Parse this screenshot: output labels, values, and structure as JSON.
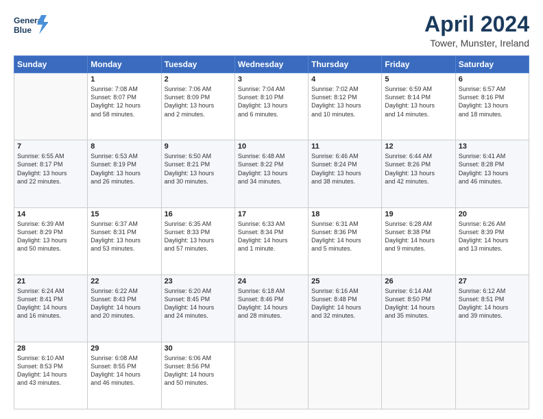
{
  "header": {
    "logo_line1": "General",
    "logo_line2": "Blue",
    "title": "April 2024",
    "subtitle": "Tower, Munster, Ireland"
  },
  "days_of_week": [
    "Sunday",
    "Monday",
    "Tuesday",
    "Wednesday",
    "Thursday",
    "Friday",
    "Saturday"
  ],
  "weeks": [
    [
      {
        "num": "",
        "info": ""
      },
      {
        "num": "1",
        "info": "Sunrise: 7:08 AM\nSunset: 8:07 PM\nDaylight: 12 hours\nand 58 minutes."
      },
      {
        "num": "2",
        "info": "Sunrise: 7:06 AM\nSunset: 8:09 PM\nDaylight: 13 hours\nand 2 minutes."
      },
      {
        "num": "3",
        "info": "Sunrise: 7:04 AM\nSunset: 8:10 PM\nDaylight: 13 hours\nand 6 minutes."
      },
      {
        "num": "4",
        "info": "Sunrise: 7:02 AM\nSunset: 8:12 PM\nDaylight: 13 hours\nand 10 minutes."
      },
      {
        "num": "5",
        "info": "Sunrise: 6:59 AM\nSunset: 8:14 PM\nDaylight: 13 hours\nand 14 minutes."
      },
      {
        "num": "6",
        "info": "Sunrise: 6:57 AM\nSunset: 8:16 PM\nDaylight: 13 hours\nand 18 minutes."
      }
    ],
    [
      {
        "num": "7",
        "info": "Sunrise: 6:55 AM\nSunset: 8:17 PM\nDaylight: 13 hours\nand 22 minutes."
      },
      {
        "num": "8",
        "info": "Sunrise: 6:53 AM\nSunset: 8:19 PM\nDaylight: 13 hours\nand 26 minutes."
      },
      {
        "num": "9",
        "info": "Sunrise: 6:50 AM\nSunset: 8:21 PM\nDaylight: 13 hours\nand 30 minutes."
      },
      {
        "num": "10",
        "info": "Sunrise: 6:48 AM\nSunset: 8:22 PM\nDaylight: 13 hours\nand 34 minutes."
      },
      {
        "num": "11",
        "info": "Sunrise: 6:46 AM\nSunset: 8:24 PM\nDaylight: 13 hours\nand 38 minutes."
      },
      {
        "num": "12",
        "info": "Sunrise: 6:44 AM\nSunset: 8:26 PM\nDaylight: 13 hours\nand 42 minutes."
      },
      {
        "num": "13",
        "info": "Sunrise: 6:41 AM\nSunset: 8:28 PM\nDaylight: 13 hours\nand 46 minutes."
      }
    ],
    [
      {
        "num": "14",
        "info": "Sunrise: 6:39 AM\nSunset: 8:29 PM\nDaylight: 13 hours\nand 50 minutes."
      },
      {
        "num": "15",
        "info": "Sunrise: 6:37 AM\nSunset: 8:31 PM\nDaylight: 13 hours\nand 53 minutes."
      },
      {
        "num": "16",
        "info": "Sunrise: 6:35 AM\nSunset: 8:33 PM\nDaylight: 13 hours\nand 57 minutes."
      },
      {
        "num": "17",
        "info": "Sunrise: 6:33 AM\nSunset: 8:34 PM\nDaylight: 14 hours\nand 1 minute."
      },
      {
        "num": "18",
        "info": "Sunrise: 6:31 AM\nSunset: 8:36 PM\nDaylight: 14 hours\nand 5 minutes."
      },
      {
        "num": "19",
        "info": "Sunrise: 6:28 AM\nSunset: 8:38 PM\nDaylight: 14 hours\nand 9 minutes."
      },
      {
        "num": "20",
        "info": "Sunrise: 6:26 AM\nSunset: 8:39 PM\nDaylight: 14 hours\nand 13 minutes."
      }
    ],
    [
      {
        "num": "21",
        "info": "Sunrise: 6:24 AM\nSunset: 8:41 PM\nDaylight: 14 hours\nand 16 minutes."
      },
      {
        "num": "22",
        "info": "Sunrise: 6:22 AM\nSunset: 8:43 PM\nDaylight: 14 hours\nand 20 minutes."
      },
      {
        "num": "23",
        "info": "Sunrise: 6:20 AM\nSunset: 8:45 PM\nDaylight: 14 hours\nand 24 minutes."
      },
      {
        "num": "24",
        "info": "Sunrise: 6:18 AM\nSunset: 8:46 PM\nDaylight: 14 hours\nand 28 minutes."
      },
      {
        "num": "25",
        "info": "Sunrise: 6:16 AM\nSunset: 8:48 PM\nDaylight: 14 hours\nand 32 minutes."
      },
      {
        "num": "26",
        "info": "Sunrise: 6:14 AM\nSunset: 8:50 PM\nDaylight: 14 hours\nand 35 minutes."
      },
      {
        "num": "27",
        "info": "Sunrise: 6:12 AM\nSunset: 8:51 PM\nDaylight: 14 hours\nand 39 minutes."
      }
    ],
    [
      {
        "num": "28",
        "info": "Sunrise: 6:10 AM\nSunset: 8:53 PM\nDaylight: 14 hours\nand 43 minutes."
      },
      {
        "num": "29",
        "info": "Sunrise: 6:08 AM\nSunset: 8:55 PM\nDaylight: 14 hours\nand 46 minutes."
      },
      {
        "num": "30",
        "info": "Sunrise: 6:06 AM\nSunset: 8:56 PM\nDaylight: 14 hours\nand 50 minutes."
      },
      {
        "num": "",
        "info": ""
      },
      {
        "num": "",
        "info": ""
      },
      {
        "num": "",
        "info": ""
      },
      {
        "num": "",
        "info": ""
      }
    ]
  ]
}
